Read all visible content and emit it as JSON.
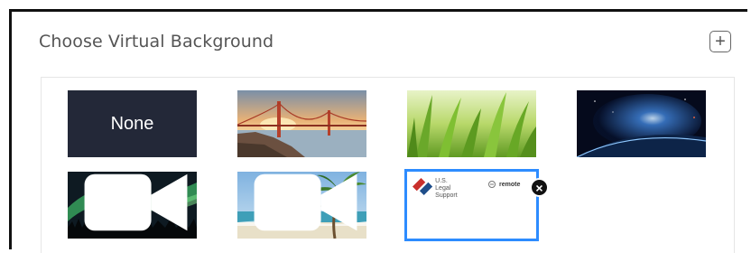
{
  "header": {
    "title": "Choose Virtual Background",
    "add_icon": "plus-icon"
  },
  "backgrounds": [
    {
      "label": "None",
      "type": "none"
    },
    {
      "label": "",
      "type": "image",
      "scene": "golden-gate-bridge"
    },
    {
      "label": "",
      "type": "image",
      "scene": "grass"
    },
    {
      "label": "",
      "type": "image",
      "scene": "earth-from-space"
    },
    {
      "label": "",
      "type": "video",
      "scene": "aurora",
      "icon": "video-icon"
    },
    {
      "label": "",
      "type": "video",
      "scene": "beach",
      "icon": "video-icon"
    },
    {
      "label": "",
      "type": "custom",
      "scene": "us-legal-support-logo",
      "selected": true,
      "close_icon": "close-icon"
    }
  ],
  "custom_logo": {
    "line1": "U.S. Legal",
    "line2": "Support",
    "partner": "remote"
  },
  "colors": {
    "selected_border": "#2d8cff",
    "none_tile": "#232838"
  }
}
